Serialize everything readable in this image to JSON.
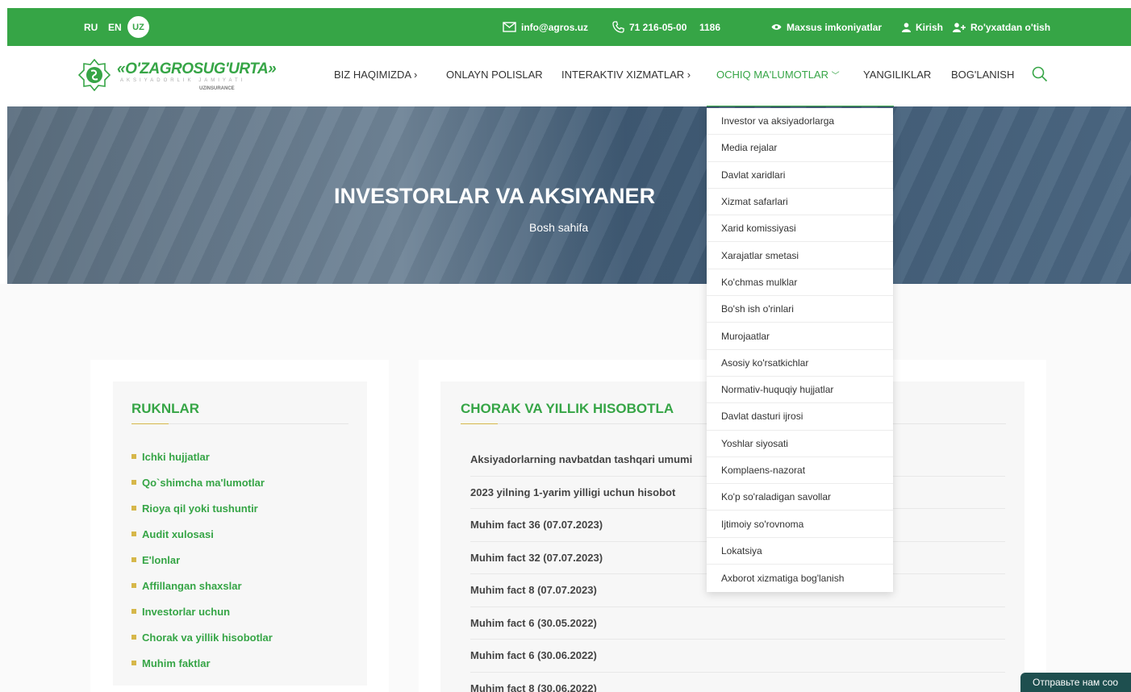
{
  "topbar": {
    "lang_ru": "RU",
    "lang_en": "EN",
    "lang_uz": "UZ",
    "email": "info@agros.uz",
    "phone": "71 216-05-00",
    "short_number": "1186",
    "accessibility": "Maxsus imkoniyatlar",
    "login": "Kirish",
    "register": "Ro'yxatdan o'tish"
  },
  "logo": {
    "name": "«O'ZAGROSUG'URTA»",
    "subtitle": "AKSIYADORLIK JAMIYATI",
    "brand": "UZINSURANCE"
  },
  "nav": {
    "about": "BIZ HAQIMIZDA",
    "online_policies": "ONLAYN POLISLAR",
    "interactive": "INTERAKTIV XIZMATLAR",
    "open_data": "OCHIQ MA'LUMOTLAR",
    "news": "YANGILIKLAR",
    "contact": "BOG'LANISH"
  },
  "hero": {
    "title": "INVESTORLAR VA AKSIYANER",
    "breadcrumb": "Bosh sahifa"
  },
  "sidebar": {
    "title": "RUKNLAR",
    "items": [
      "Ichki hujjatlar",
      "Qo`shimcha ma'lumotlar",
      "Rioya qil yoki tushuntir",
      "Audit xulosasi",
      "E'lonlar",
      "Affillangan shaxslar",
      "Investorlar uchun",
      "Chorak va yillik hisobotlar",
      "Muhim faktlar"
    ]
  },
  "main": {
    "title": "CHORAK VA YILLIK HISOBOTLA",
    "items": [
      "Aksiyadorlarning navbatdan tashqari umumi",
      "2023 yilning 1-yarim yilligi uchun hisobot",
      "Muhim fact 36 (07.07.2023)",
      "Muhim fact 32 (07.07.2023)",
      "Muhim fact 8 (07.07.2023)",
      "Muhim fact 6 (30.05.2022)",
      "Muhim fact 6 (30.06.2022)",
      "Muhim fact 8 (30.06.2022)"
    ]
  },
  "dropdown": {
    "items": [
      "Investor va aksiyadorlarga",
      "Media rejalar",
      "Davlat xaridlari",
      "Xizmat safarlari",
      "Xarid komissiyasi",
      "Xarajatlar smetasi",
      "Ko'chmas mulklar",
      "Bo'sh ish o'rinlari",
      "Murojaatlar",
      "Asosiy ko'rsatkichlar",
      "Normativ-huquqiy hujjatlar",
      "Davlat dasturi ijrosi",
      "Yoshlar siyosati",
      "Komplaens-nazorat",
      "Ko'p so'raladigan savollar",
      "Ijtimoiy so'rovnoma",
      "Lokatsiya",
      "Axborot xizmatiga bog'lanish"
    ]
  },
  "chat": {
    "label": "Отправьте нам соо"
  },
  "colors": {
    "brand_green": "#36a546",
    "accent_gold": "#d6b74a"
  }
}
